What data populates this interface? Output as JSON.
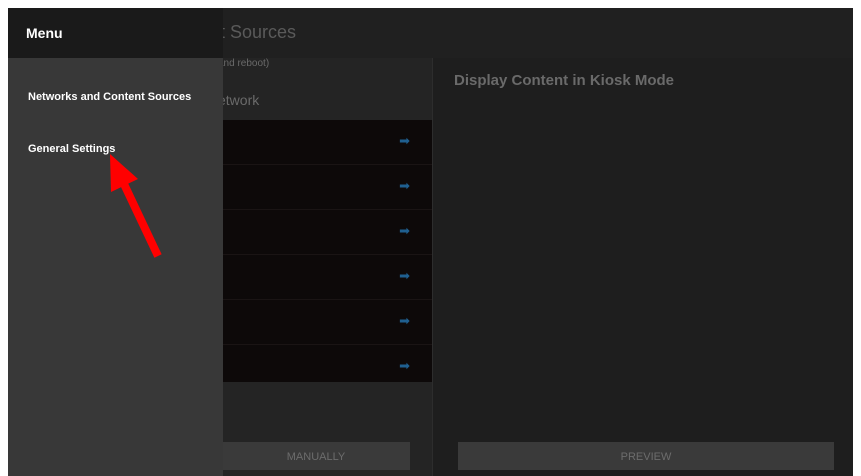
{
  "background_app": {
    "title_fragment": "t Sources",
    "subtitle_fragment": "and reboot)",
    "network_fragment": "etwork",
    "manual_button_fragment": "MANUALLY",
    "right_panel_title": "Display Content in Kiosk Mode",
    "preview_button": "PREVIEW",
    "row_arrow_icon": "right-arrow-icon",
    "row_count": 6
  },
  "menu": {
    "title": "Menu",
    "items": [
      {
        "label": "Networks and Content Sources"
      },
      {
        "label": "General Settings"
      }
    ]
  },
  "annotation": {
    "arrow_color": "#ff0000",
    "icon": "red-pointer-arrow"
  },
  "colors": {
    "accent_arrow": "#1f5f8f",
    "drawer_bg": "#383838",
    "header_bg": "#1a1a1a"
  }
}
